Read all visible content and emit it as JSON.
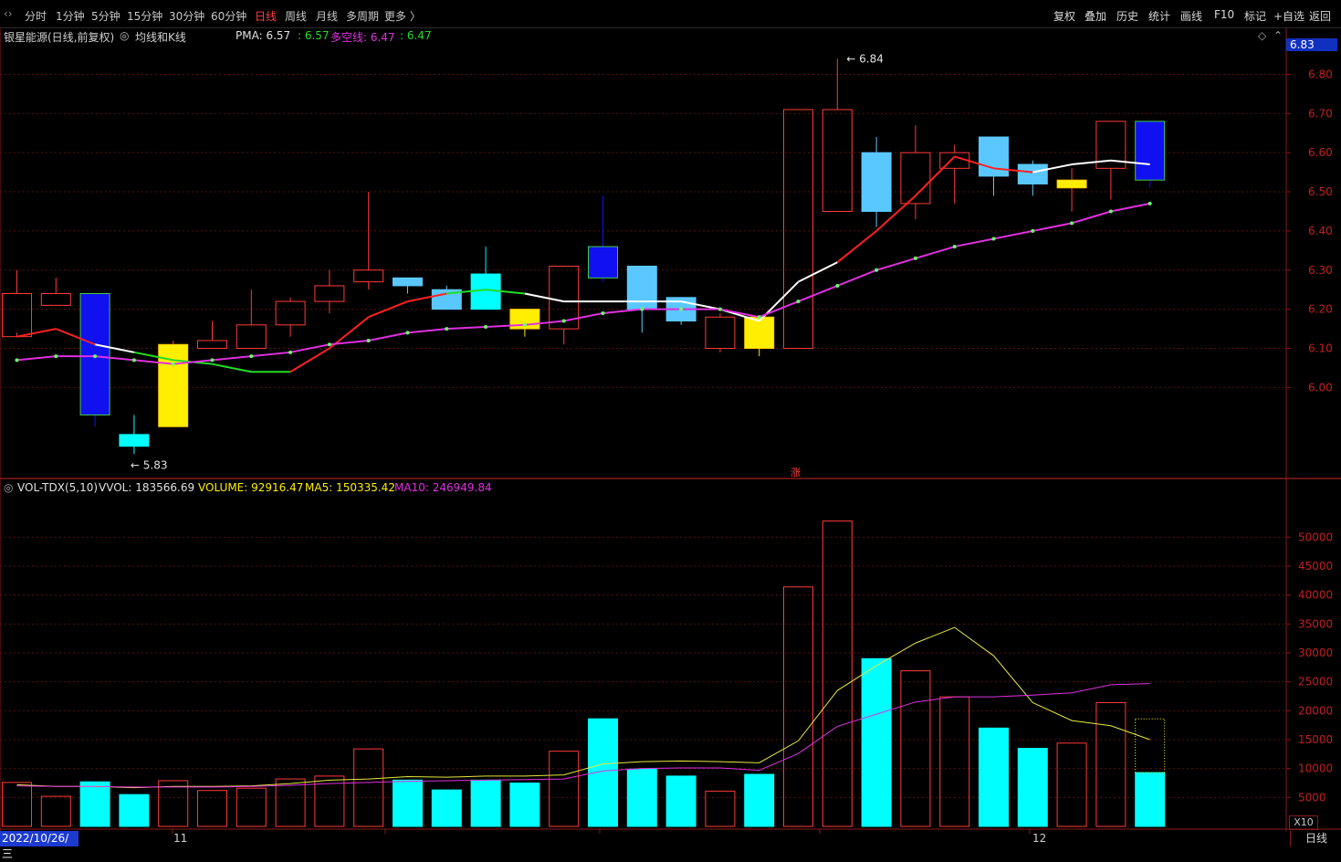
{
  "toolbar": {
    "periods": [
      {
        "label": "分时",
        "active": false
      },
      {
        "label": "1分钟",
        "active": false
      },
      {
        "label": "5分钟",
        "active": false
      },
      {
        "label": "15分钟",
        "active": false
      },
      {
        "label": "30分钟",
        "active": false
      },
      {
        "label": "60分钟",
        "active": false
      },
      {
        "label": "日线",
        "active": true
      },
      {
        "label": "周线",
        "active": false
      },
      {
        "label": "月线",
        "active": false
      },
      {
        "label": "多周期",
        "active": false
      },
      {
        "label": "更多 〉",
        "active": false
      }
    ],
    "right_buttons": [
      "复权",
      "叠加",
      "历史",
      "统计",
      "画线",
      "F10",
      "标记",
      "+自选",
      "返回"
    ]
  },
  "main_panel": {
    "stock_title": "银星能源(日线,前复权)",
    "indicator_name": "均线和K线",
    "pma_label": "PMA: 6.57",
    "pma_value2": ": 6.57",
    "duokong_label": "多空线: 6.47",
    "duokong_value2": ": 6.47",
    "high_marker": "6.84",
    "low_marker": "5.83",
    "current_price": "6.83",
    "y_ticks": [
      "6.80",
      "6.70",
      "6.60",
      "6.50",
      "6.40",
      "6.30",
      "6.20",
      "6.10",
      "6.00"
    ],
    "zhang_marker": "涨"
  },
  "volume_panel": {
    "indicator": "VOL-TDX(5,10)",
    "vvol": "VVOL: 183566.69",
    "volume": "VOLUME: 92916.47",
    "ma5": "MA5: 150335.42",
    "ma10": "MA10: 246949.84",
    "y_ticks": [
      "50000",
      "45000",
      "40000",
      "35000",
      "30000",
      "25000",
      "20000",
      "15000",
      "10000",
      "5000"
    ],
    "scale_label": "X10"
  },
  "bottom_bar": {
    "date_label": "2022/10/26/三",
    "month_11": "11",
    "month_12": "12",
    "period_label": "日线"
  },
  "colors": {
    "up": "#ff3a3a",
    "down": "#5ac8ff",
    "cyan": "#00ffff",
    "yellow": "#ffee00",
    "blue": "#1010f0",
    "ma_red": "#ff2020",
    "ma_white": "#ffffff",
    "ma_green": "#22dd22",
    "ma_magenta": "#e030e0",
    "vol_ma5": "#e8e840"
  },
  "chart_data": {
    "type": "candlestick",
    "title": "银星能源(日线,前复权)",
    "candles": [
      {
        "o": 6.13,
        "h": 6.3,
        "l": 6.14,
        "c": 6.24
      },
      {
        "o": 6.21,
        "h": 6.28,
        "l": 6.21,
        "c": 6.24
      },
      {
        "o": 6.24,
        "h": 6.24,
        "l": 5.9,
        "c": 5.93
      },
      {
        "o": 5.88,
        "h": 5.93,
        "l": 5.83,
        "c": 5.85
      },
      {
        "o": 5.9,
        "h": 6.12,
        "l": 5.9,
        "c": 6.11
      },
      {
        "o": 6.1,
        "h": 6.17,
        "l": 6.1,
        "c": 6.12
      },
      {
        "o": 6.1,
        "h": 6.25,
        "l": 6.1,
        "c": 6.16
      },
      {
        "o": 6.16,
        "h": 6.23,
        "l": 6.13,
        "c": 6.22
      },
      {
        "o": 6.22,
        "h": 6.3,
        "l": 6.19,
        "c": 6.26
      },
      {
        "o": 6.27,
        "h": 6.5,
        "l": 6.25,
        "c": 6.3
      },
      {
        "o": 6.28,
        "h": 6.28,
        "l": 6.24,
        "c": 6.26
      },
      {
        "o": 6.25,
        "h": 6.26,
        "l": 6.2,
        "c": 6.2
      },
      {
        "o": 6.29,
        "h": 6.36,
        "l": 6.2,
        "c": 6.2
      },
      {
        "o": 6.2,
        "h": 6.2,
        "l": 6.13,
        "c": 6.15
      },
      {
        "o": 6.15,
        "h": 6.31,
        "l": 6.11,
        "c": 6.31
      },
      {
        "o": 6.36,
        "h": 6.49,
        "l": 6.27,
        "c": 6.28
      },
      {
        "o": 6.31,
        "h": 6.31,
        "l": 6.14,
        "c": 6.2
      },
      {
        "o": 6.23,
        "h": 6.23,
        "l": 6.16,
        "c": 6.17
      },
      {
        "o": 6.1,
        "h": 6.19,
        "l": 6.09,
        "c": 6.18
      },
      {
        "o": 6.18,
        "h": 6.18,
        "l": 6.08,
        "c": 6.1
      },
      {
        "o": 6.1,
        "h": 6.71,
        "l": 6.1,
        "c": 6.71
      },
      {
        "o": 6.45,
        "h": 6.84,
        "l": 6.45,
        "c": 6.71
      },
      {
        "o": 6.6,
        "h": 6.64,
        "l": 6.41,
        "c": 6.45
      },
      {
        "o": 6.47,
        "h": 6.67,
        "l": 6.43,
        "c": 6.6
      },
      {
        "o": 6.56,
        "h": 6.62,
        "l": 6.47,
        "c": 6.6
      },
      {
        "o": 6.64,
        "h": 6.64,
        "l": 6.49,
        "c": 6.54
      },
      {
        "o": 6.57,
        "h": 6.58,
        "l": 6.49,
        "c": 6.52
      },
      {
        "o": 6.51,
        "h": 6.56,
        "l": 6.45,
        "c": 6.53
      },
      {
        "o": 6.56,
        "h": 6.68,
        "l": 6.48,
        "c": 6.68
      },
      {
        "o": 6.68,
        "h": 6.68,
        "l": 6.51,
        "c": 6.53
      }
    ],
    "pma": [
      6.13,
      6.15,
      6.11,
      6.09,
      6.07,
      6.06,
      6.04,
      6.04,
      6.1,
      6.18,
      6.22,
      6.24,
      6.25,
      6.24,
      6.22,
      6.22,
      6.22,
      6.22,
      6.2,
      6.17,
      6.27,
      6.32,
      6.4,
      6.49,
      6.59,
      6.56,
      6.55,
      6.57,
      6.58,
      6.57
    ],
    "duokong": [
      6.07,
      6.08,
      6.08,
      6.07,
      6.06,
      6.07,
      6.08,
      6.09,
      6.11,
      6.12,
      6.14,
      6.15,
      6.155,
      6.16,
      6.17,
      6.19,
      6.2,
      6.2,
      6.2,
      6.18,
      6.22,
      6.26,
      6.3,
      6.33,
      6.36,
      6.38,
      6.4,
      6.42,
      6.45,
      6.47
    ],
    "volume": [
      7600,
      5200,
      7700,
      5500,
      7900,
      6200,
      6600,
      8200,
      8700,
      13400,
      8000,
      6300,
      8000,
      7500,
      13000,
      18600,
      9900,
      8700,
      6100,
      9000,
      41400,
      52800,
      29000,
      26900,
      22400,
      17000,
      13500,
      14400,
      21400,
      9300
    ],
    "vol_ma5": [
      7200,
      6900,
      6900,
      6700,
      6900,
      6900,
      7000,
      7400,
      8000,
      8200,
      8600,
      8500,
      8700,
      8700,
      8900,
      10800,
      11200,
      11300,
      11200,
      11000,
      14800,
      23500,
      27800,
      31700,
      34400,
      29500,
      21400,
      18300,
      17400,
      15000
    ],
    "vol_ma10": [
      7000,
      6900,
      6900,
      6800,
      6800,
      6800,
      6900,
      7100,
      7400,
      7600,
      7800,
      7900,
      8000,
      8100,
      8200,
      9600,
      10000,
      10100,
      10100,
      9700,
      12600,
      17300,
      19400,
      21500,
      22400,
      22400,
      22700,
      23100,
      24500,
      24700
    ],
    "price_ylim": [
      5.77,
      6.92
    ],
    "volume_ylim": [
      0,
      57000
    ]
  }
}
